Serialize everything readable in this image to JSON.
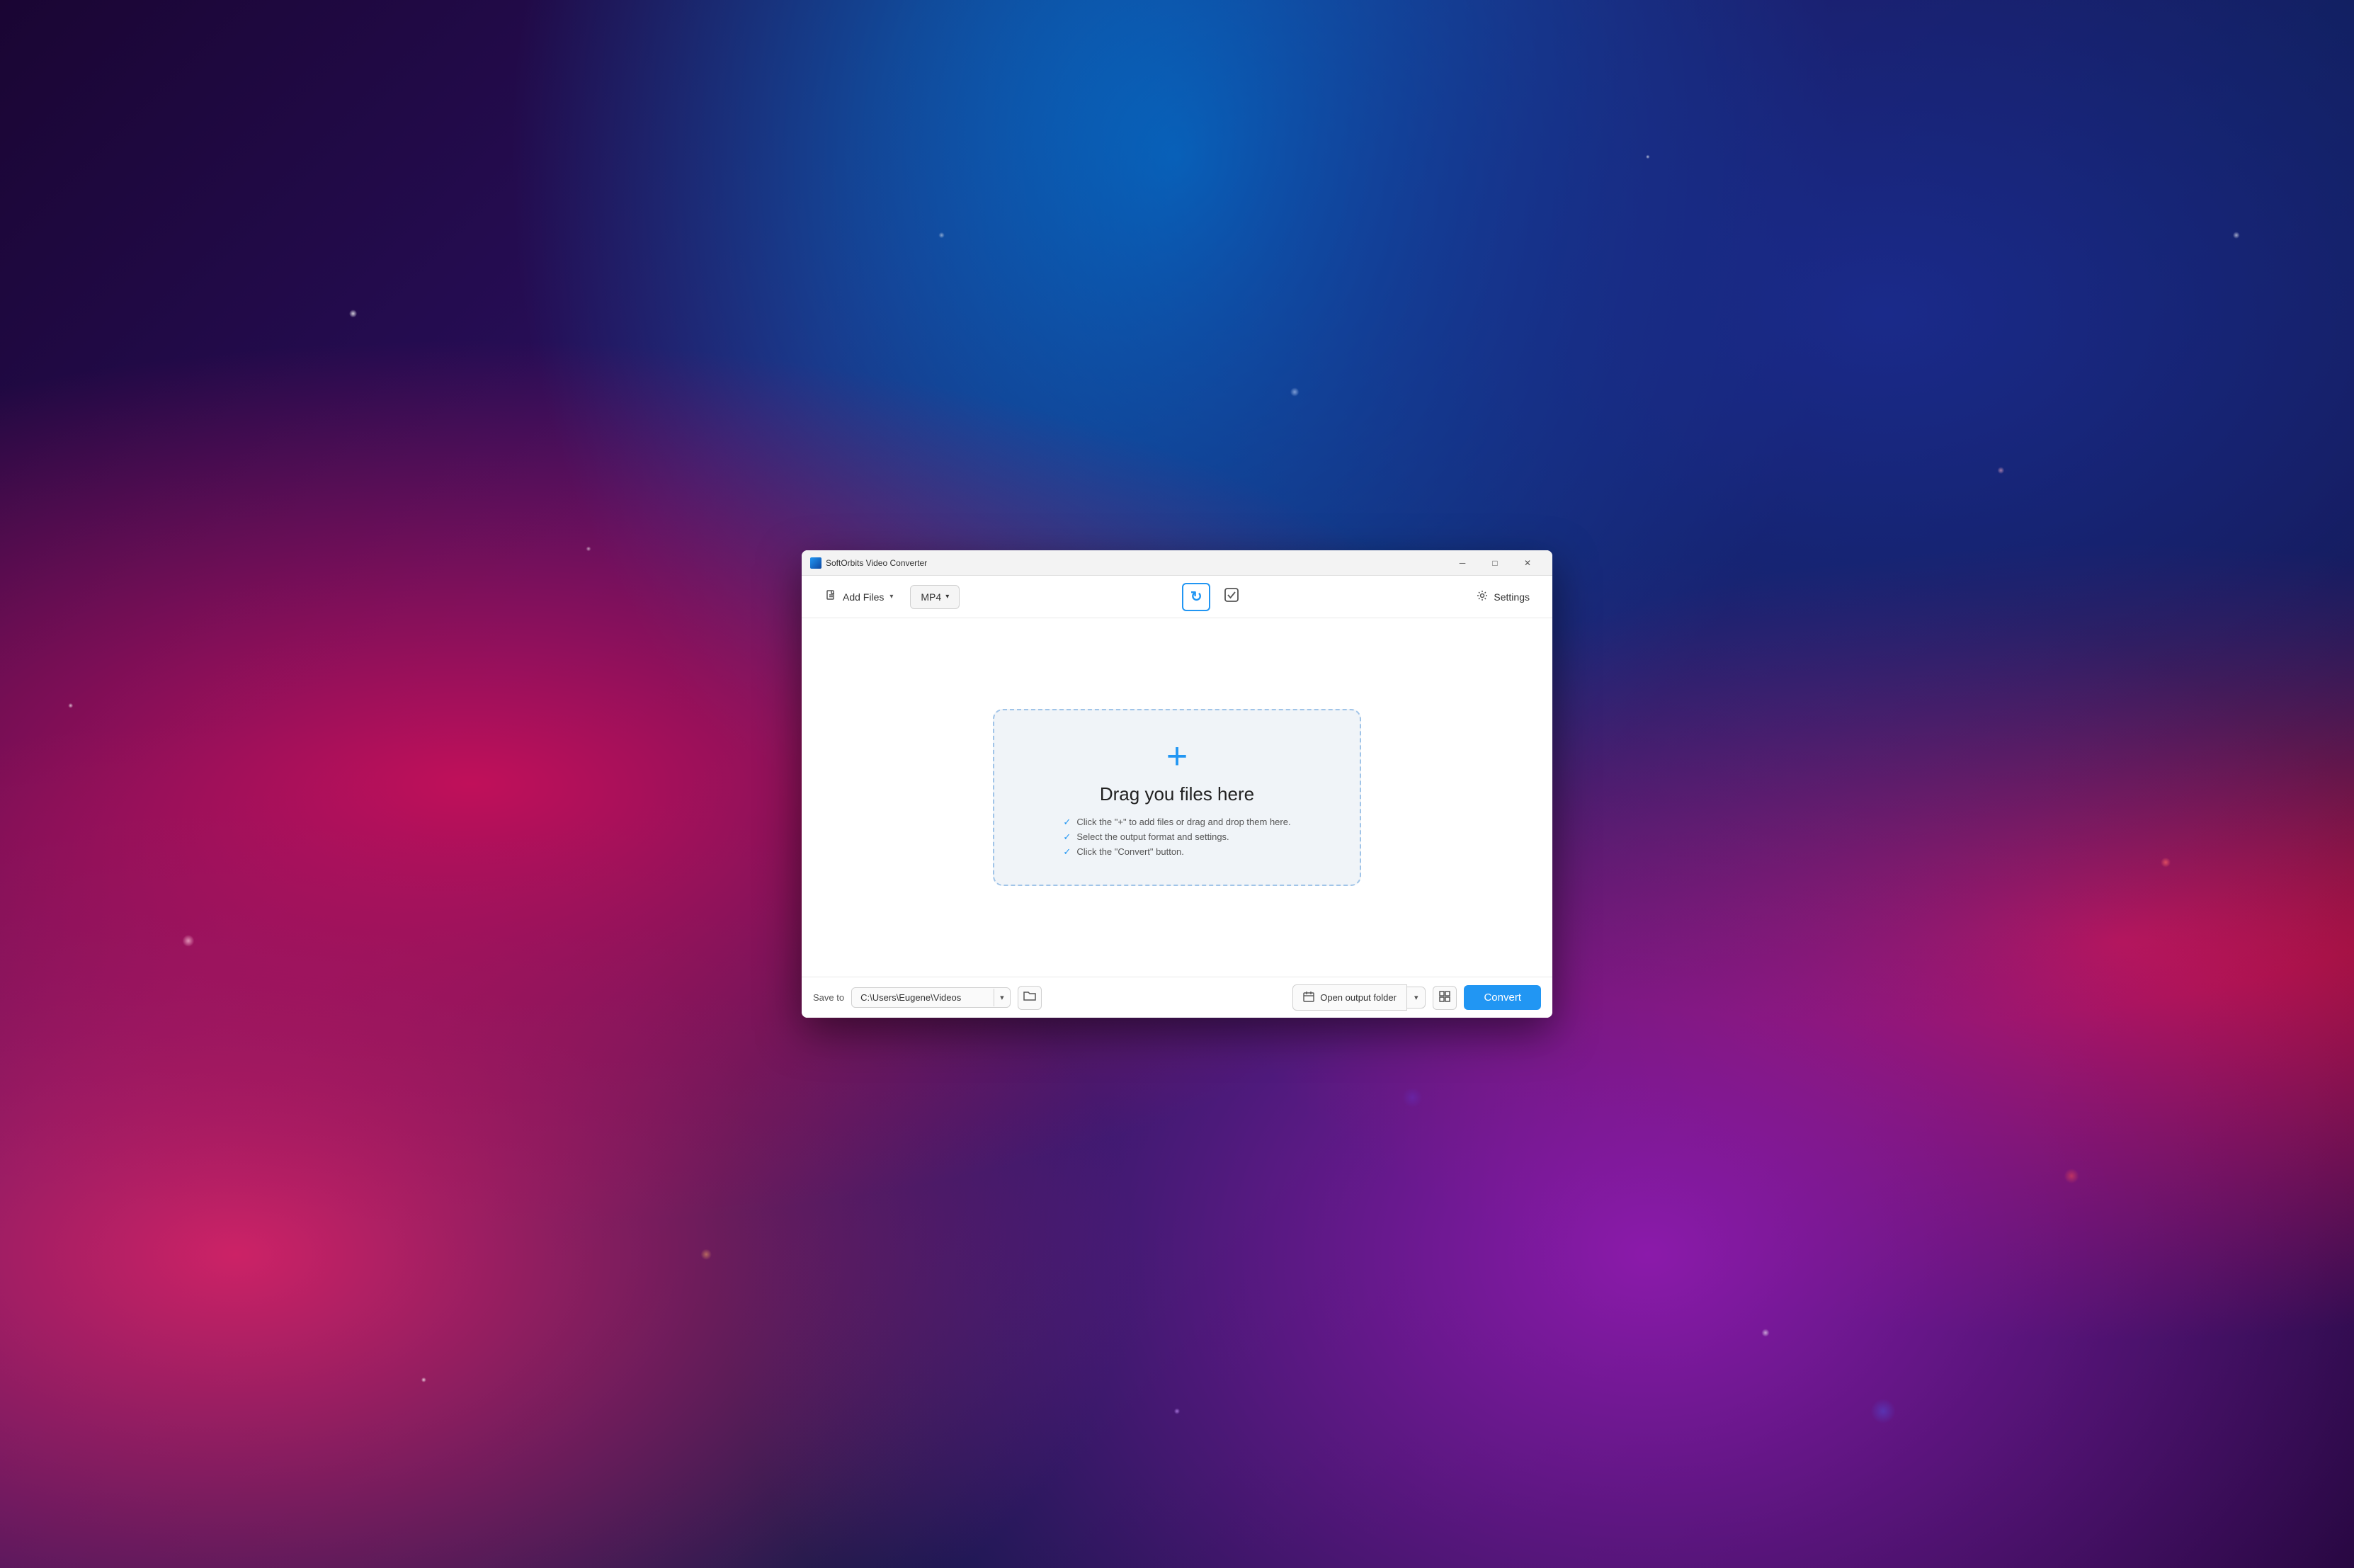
{
  "window": {
    "title": "SoftOrbits Video Converter",
    "titlebar_icon_alt": "app-icon"
  },
  "titlebar_controls": {
    "minimize": "─",
    "maximize": "□",
    "close": "✕"
  },
  "toolbar": {
    "add_files_label": "Add Files",
    "format_label": "MP4",
    "refresh_icon": "↻",
    "check_icon": "✔",
    "settings_label": "Settings"
  },
  "dropzone": {
    "plus_icon": "+",
    "title": "Drag you files here",
    "hints": [
      "Click the \"+\" to add files or drag and drop them here.",
      "Select the output format and settings.",
      "Click the \"Convert\" button."
    ]
  },
  "footer": {
    "save_to_label": "Save to",
    "save_path": "C:\\Users\\Eugene\\Videos",
    "open_output_label": "Open output folder",
    "convert_label": "Convert"
  }
}
